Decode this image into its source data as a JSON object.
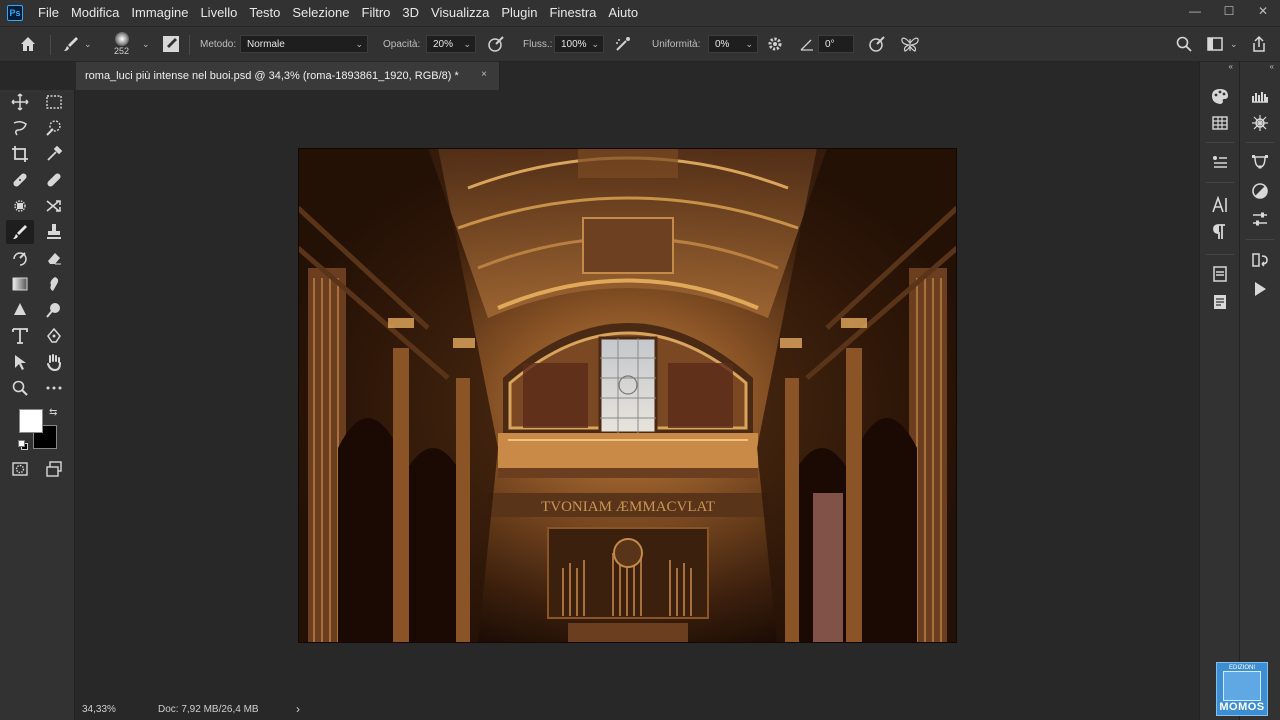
{
  "app": {
    "logo_text": "Ps"
  },
  "menu": [
    "File",
    "Modifica",
    "Immagine",
    "Livello",
    "Testo",
    "Selezione",
    "Filtro",
    "3D",
    "Visualizza",
    "Plugin",
    "Finestra",
    "Aiuto"
  ],
  "window_controls": {
    "minimize": "—",
    "maximize": "☐",
    "close": "✕"
  },
  "options_bar": {
    "brush_size": "252",
    "mode_label": "Metodo:",
    "mode_value": "Normale",
    "opacity_label": "Opacità:",
    "opacity_value": "20%",
    "flow_label": "Fluss.:",
    "flow_value": "100%",
    "smoothing_label": "Uniformità:",
    "smoothing_value": "0%",
    "angle_value": "0°"
  },
  "document": {
    "tab_title": "roma_luci più intense nel buoi.psd @ 34,3% (roma-1893861_1920, RGB/8) *",
    "close_glyph": "×",
    "artwork_inscription": "TVONIAM ÆMMACVLAT"
  },
  "status": {
    "zoom": "34,33%",
    "doc": "Doc: 7,92 MB/26,4 MB",
    "arrow": "›"
  },
  "colors": {
    "foreground": "#ffffff",
    "background": "#000000",
    "accent": "#31a8ff"
  },
  "panel_collapse": "«",
  "badge": {
    "top": "EDIZIONI",
    "brand": "MOMOS"
  }
}
